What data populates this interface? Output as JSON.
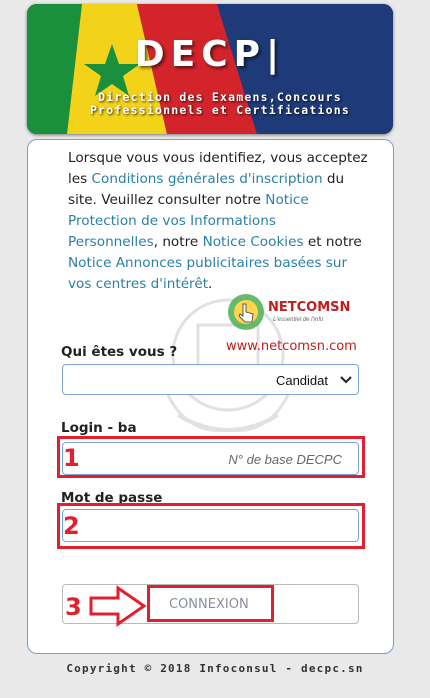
{
  "banner": {
    "title": "DECP|",
    "subtitle_line1": "Direction des Examens,Concours",
    "subtitle_line2": "Professionnels et Certifications"
  },
  "intro": {
    "t1": "Lorsque vous vous identifiez, vous acceptez les ",
    "link_conditions": "Conditions générales d'inscription",
    "t2": " du site. Veuillez consulter notre ",
    "link_privacy": "Notice Protection de vos Informations Personnelles",
    "t3": ", notre ",
    "link_cookies": "Notice Cookies",
    "t4": " et notre ",
    "link_ads": "Notice Annonces publicitaires basées sur vos centres d'intérêt",
    "t5": "."
  },
  "watermark": {
    "brand": "NETCOMSN",
    "tagline": "L'essentiel de l'info",
    "url": "www.netcomsn.com"
  },
  "form": {
    "who_label": "Qui êtes vous ?",
    "who_value": "Candidat",
    "login_label": "Login - ba",
    "login_placeholder": "N° de base DECPC",
    "password_label": "Mot de passe",
    "submit_label": "CONNEXION"
  },
  "annotations": {
    "step1": "1",
    "step2": "2",
    "step3": "3",
    "color": "#e0202e"
  },
  "footer": {
    "text": "Copyright © 2018 Infoconsul - decpc.sn"
  }
}
